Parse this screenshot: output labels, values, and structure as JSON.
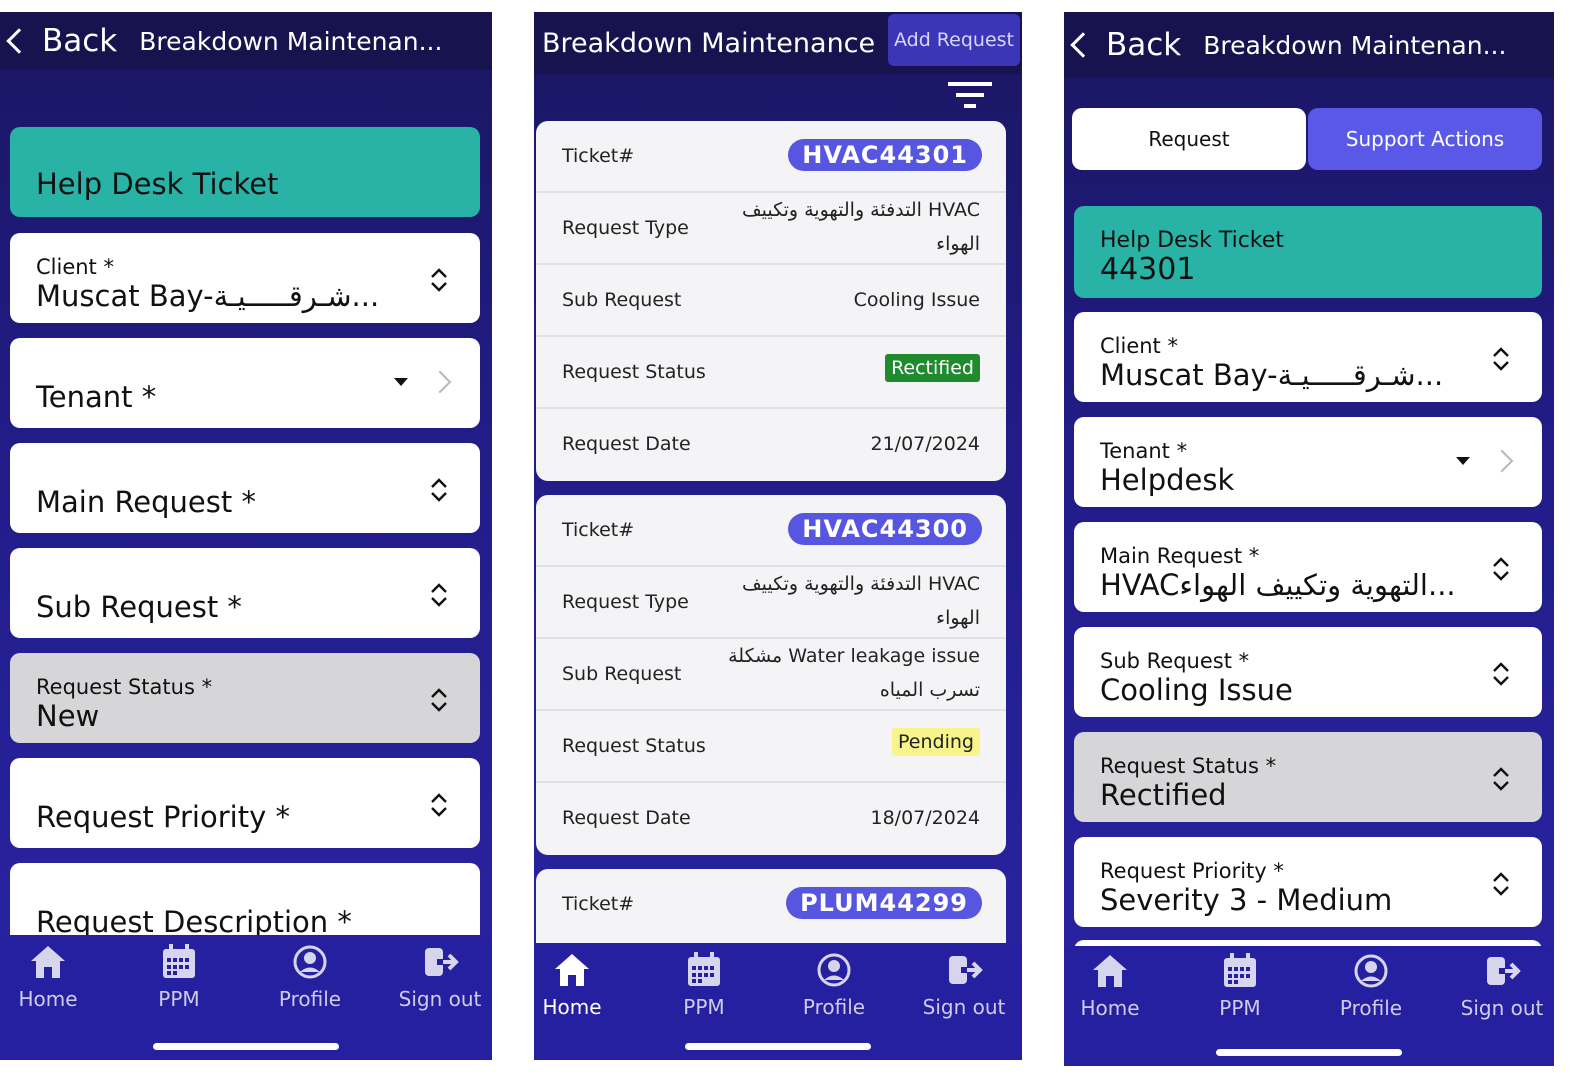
{
  "header": {
    "back_label": "Back",
    "title_truncated": "Breakdown Maintenan...",
    "title_full": "Breakdown Maintenance",
    "add_request_label": "Add Request"
  },
  "form1": {
    "ticket_title": "Help Desk Ticket",
    "client_label": "Client *",
    "client_value": "Muscat Bay-شـرقـــــيـة...",
    "tenant_label": "Tenant *",
    "main_request_label": "Main Request *",
    "sub_request_label": "Sub Request *",
    "status_label": "Request Status *",
    "status_value": "New",
    "priority_label": "Request Priority *",
    "description_label": "Request Description *"
  },
  "list": {
    "labels": {
      "ticket": "Ticket#",
      "type": "Request Type",
      "sub": "Sub Request",
      "status": "Request Status",
      "date": "Request Date"
    },
    "items": [
      {
        "ticket": "HVAC44301",
        "type_line1": "التدفئة والتهوية وتكييف HVAC",
        "type_line2": "الهواء",
        "sub_line1": "Cooling Issue",
        "sub_line2": "",
        "status": "Rectified",
        "date": "21/07/2024"
      },
      {
        "ticket": "HVAC44300",
        "type_line1": "التدفئة والتهوية وتكييف HVAC",
        "type_line2": "الهواء",
        "sub_line1": "مشكلة Water leakage issue",
        "sub_line2": "تسرب المياه",
        "status": "Pending",
        "date": "18/07/2024"
      },
      {
        "ticket": "PLUM44299"
      }
    ],
    "status_colors": {
      "Rectified": "#1f8a2e",
      "Pending": "#f6f48a"
    }
  },
  "form3": {
    "tabs": [
      "Request",
      "Support Actions"
    ],
    "ticket_title": "Help Desk Ticket",
    "ticket_number": "44301",
    "client_label": "Client *",
    "client_value": "Muscat Bay-شـرقـــــيـة...",
    "tenant_label": "Tenant *",
    "tenant_value": "Helpdesk",
    "main_request_label": "Main Request *",
    "main_request_value": "...التهوية وتكييف الهواءHVAC",
    "sub_request_label": "Sub Request *",
    "sub_request_value": "Cooling Issue",
    "status_label": "Request Status *",
    "status_value": "Rectified",
    "priority_label": "Request Priority *",
    "priority_value": "Severity 3 - Medium"
  },
  "tabbar": {
    "items": [
      "Home",
      "PPM",
      "Profile",
      "Sign out"
    ]
  },
  "colors": {
    "header": "#17134f",
    "accent": "#28b3a6",
    "pill": "#5656e0",
    "tabbar": "#2520a0"
  }
}
